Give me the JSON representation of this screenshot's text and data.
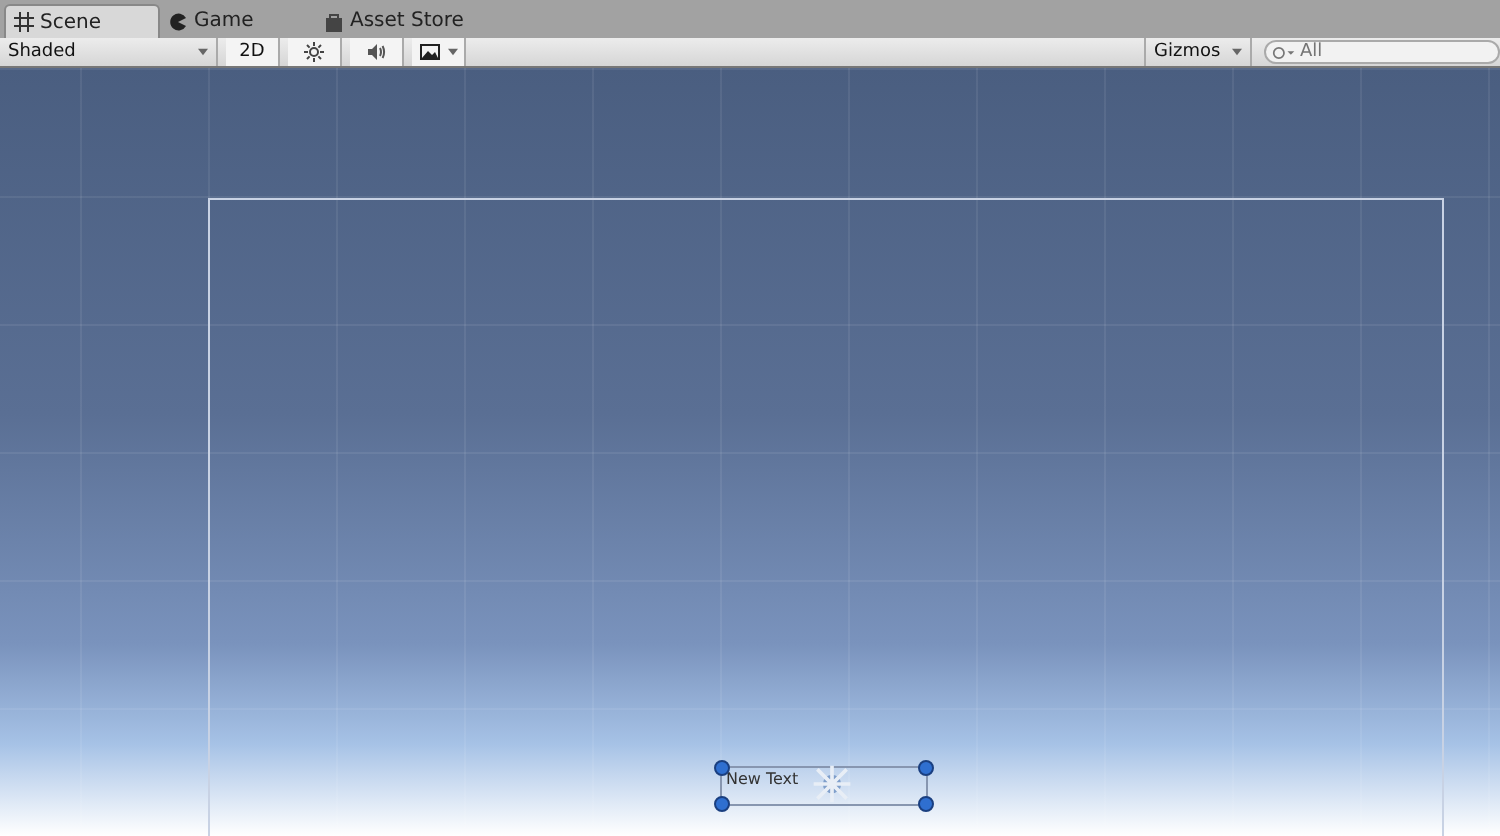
{
  "tabs": [
    {
      "label": "Scene",
      "kind": "scene",
      "selected": true
    },
    {
      "label": "Game",
      "kind": "game",
      "selected": false
    },
    {
      "label": "Asset Store",
      "kind": "store",
      "selected": false
    }
  ],
  "toolbar": {
    "draw_mode": "Shaded",
    "mode_button": "2D",
    "lighting_on": false,
    "audio_on": false,
    "gizmos": "Gizmos",
    "search": {
      "placeholder": "All"
    }
  },
  "scene": {
    "text_object": {
      "label": "New Text"
    }
  }
}
